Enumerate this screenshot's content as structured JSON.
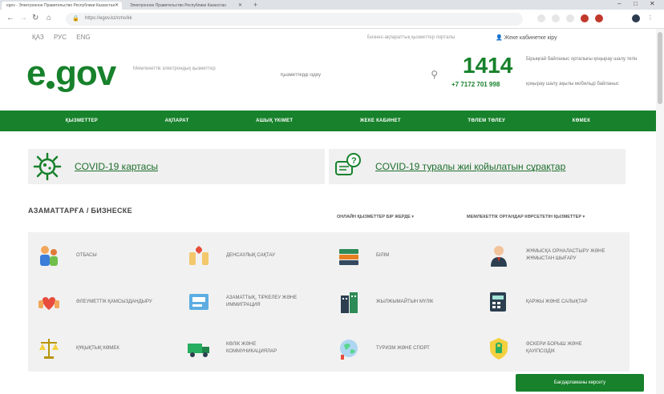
{
  "browser": {
    "tabs": [
      {
        "title": "egov - Электронное Правительство Республики Казахстан"
      },
      {
        "title": "Электронное Правительство Республики Казахстан"
      }
    ],
    "url": "https://egov.kz/cms/kk"
  },
  "header": {
    "languages": [
      "ҚАЗ",
      "РУС",
      "ENG"
    ],
    "top_note": "Бизнес-ақпараттық қызметтер порталы",
    "login": "Жеке кабинетке кіру",
    "logo_text": "egov",
    "logo_subtitle": "Мемлекеттік электрондық қызметтер",
    "search_placeholder": "Қызметтерді іздеу",
    "phone_short": "1414",
    "phone_short_desc": "Бірыңғай байланыс орталығы қоңырау шалу тегін",
    "phone_long": "+7 7172 701 998",
    "phone_long_desc": "қоңырау шалу ақылы мобильді байланыс"
  },
  "nav": [
    "ҚЫЗМЕТТЕР",
    "АҚПАРАТ",
    "АШЫҚ ҮКІМЕТ",
    "ЖЕКЕ КАБИНЕТ",
    "ТӨЛЕМ ТӨЛЕУ",
    "КӨМЕК"
  ],
  "covid": {
    "map_link": "COVID-19 картасы",
    "faq_link": "COVID-19 туралы жиі қойылатын сұрақтар"
  },
  "section": {
    "title": "АЗАМАТТАРҒА / БИЗНЕСКЕ",
    "filter_left": "ОНЛАЙН ҚЫЗМЕТТЕР БІР ЖЕРДЕ ▾",
    "filter_right": "МЕМЛЕКЕТТІК ОРГАНДАР КӨРСЕТЕТІН ҚЫЗМЕТТЕР ▾"
  },
  "services": [
    {
      "label": "ОТБАСЫ",
      "icon": "family-icon"
    },
    {
      "label": "ДЕНСАУЛЫҚ САҚТАУ",
      "icon": "health-icon"
    },
    {
      "label": "БІЛІМ",
      "icon": "books-icon"
    },
    {
      "label": "ЖҰМЫСҚА ОРНАЛАСТЫРУ ЖӘНЕ ЖҰМЫСТАН ШЫҒАРУ",
      "icon": "worker-icon"
    },
    {
      "label": "ӘЛЕУМЕТТІК ҚАМСЫЗДАНДЫРУ",
      "icon": "social-icon"
    },
    {
      "label": "АЗАМАТТЫҚ, ТІРКЕЛЕУ ЖӘНЕ ИММИГРАЦИЯ",
      "icon": "citizenship-icon"
    },
    {
      "label": "ЖЫЛЖЫМАЙТЫН МҮЛІК",
      "icon": "building-icon"
    },
    {
      "label": "ҚАРЖЫ ЖӘНЕ САЛЫҚТАР",
      "icon": "finance-icon"
    },
    {
      "label": "ҚҰҚЫҚТЫҚ КӨМЕК",
      "icon": "justice-icon"
    },
    {
      "label": "КӨЛІК ЖӘНЕ КОММУНИКАЦИЯЛАР",
      "icon": "truck-icon"
    },
    {
      "label": "ТУРИЗМ ЖӘНЕ СПОРТ",
      "icon": "tourism-icon"
    },
    {
      "label": "ӘСКЕРИ БОРЫШ ЖӘНЕ ҚАУІПСІЗДІК",
      "icon": "security-icon"
    }
  ],
  "cta": "Бағдарламаны көрсету",
  "colors": {
    "brand_green": "#17812b",
    "panel_gray": "#f1f1f1"
  }
}
